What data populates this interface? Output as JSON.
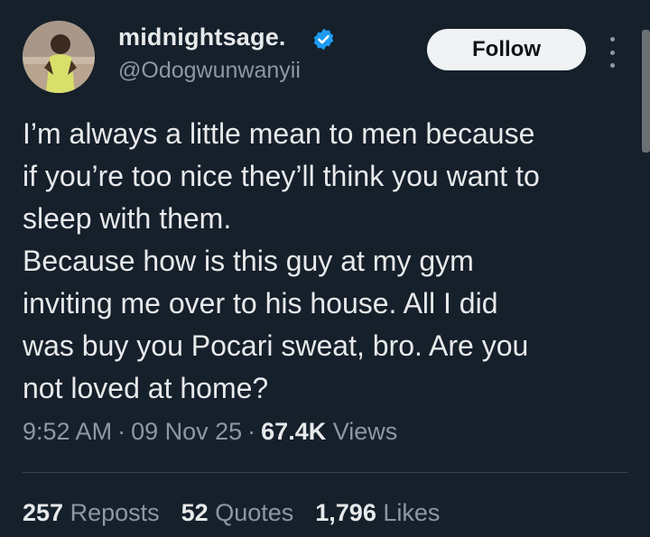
{
  "author": {
    "display_name": "midnightsage.",
    "handle": "@Odogwunwanyii",
    "verified": true
  },
  "follow_button": {
    "label": "Follow"
  },
  "tweet": {
    "lines": [
      "I’m always a little mean to men because",
      "if you’re too nice they’ll think you want to",
      "sleep with them.",
      "Because how is this guy at my gym",
      "inviting me over to his house. All I did",
      "was buy you Pocari sweat, bro. Are you",
      "not loved at home?"
    ]
  },
  "meta": {
    "time": "9:52 AM",
    "separator": "·",
    "date": "09 Nov 25",
    "views_count": "67.4K",
    "views_label": "Views"
  },
  "stats": {
    "reposts_count": "257",
    "reposts_label": "Reposts",
    "quotes_count": "52",
    "quotes_label": "Quotes",
    "likes_count": "1,796",
    "likes_label": "Likes"
  },
  "colors": {
    "background": "#15202b",
    "text_primary": "#e7e9ea",
    "text_secondary": "#8b98a5",
    "verified_blue": "#1d9bf0",
    "follow_bg": "#eff3f4"
  },
  "icons": {
    "verified": "verified-badge-icon",
    "more": "more-options-icon"
  }
}
